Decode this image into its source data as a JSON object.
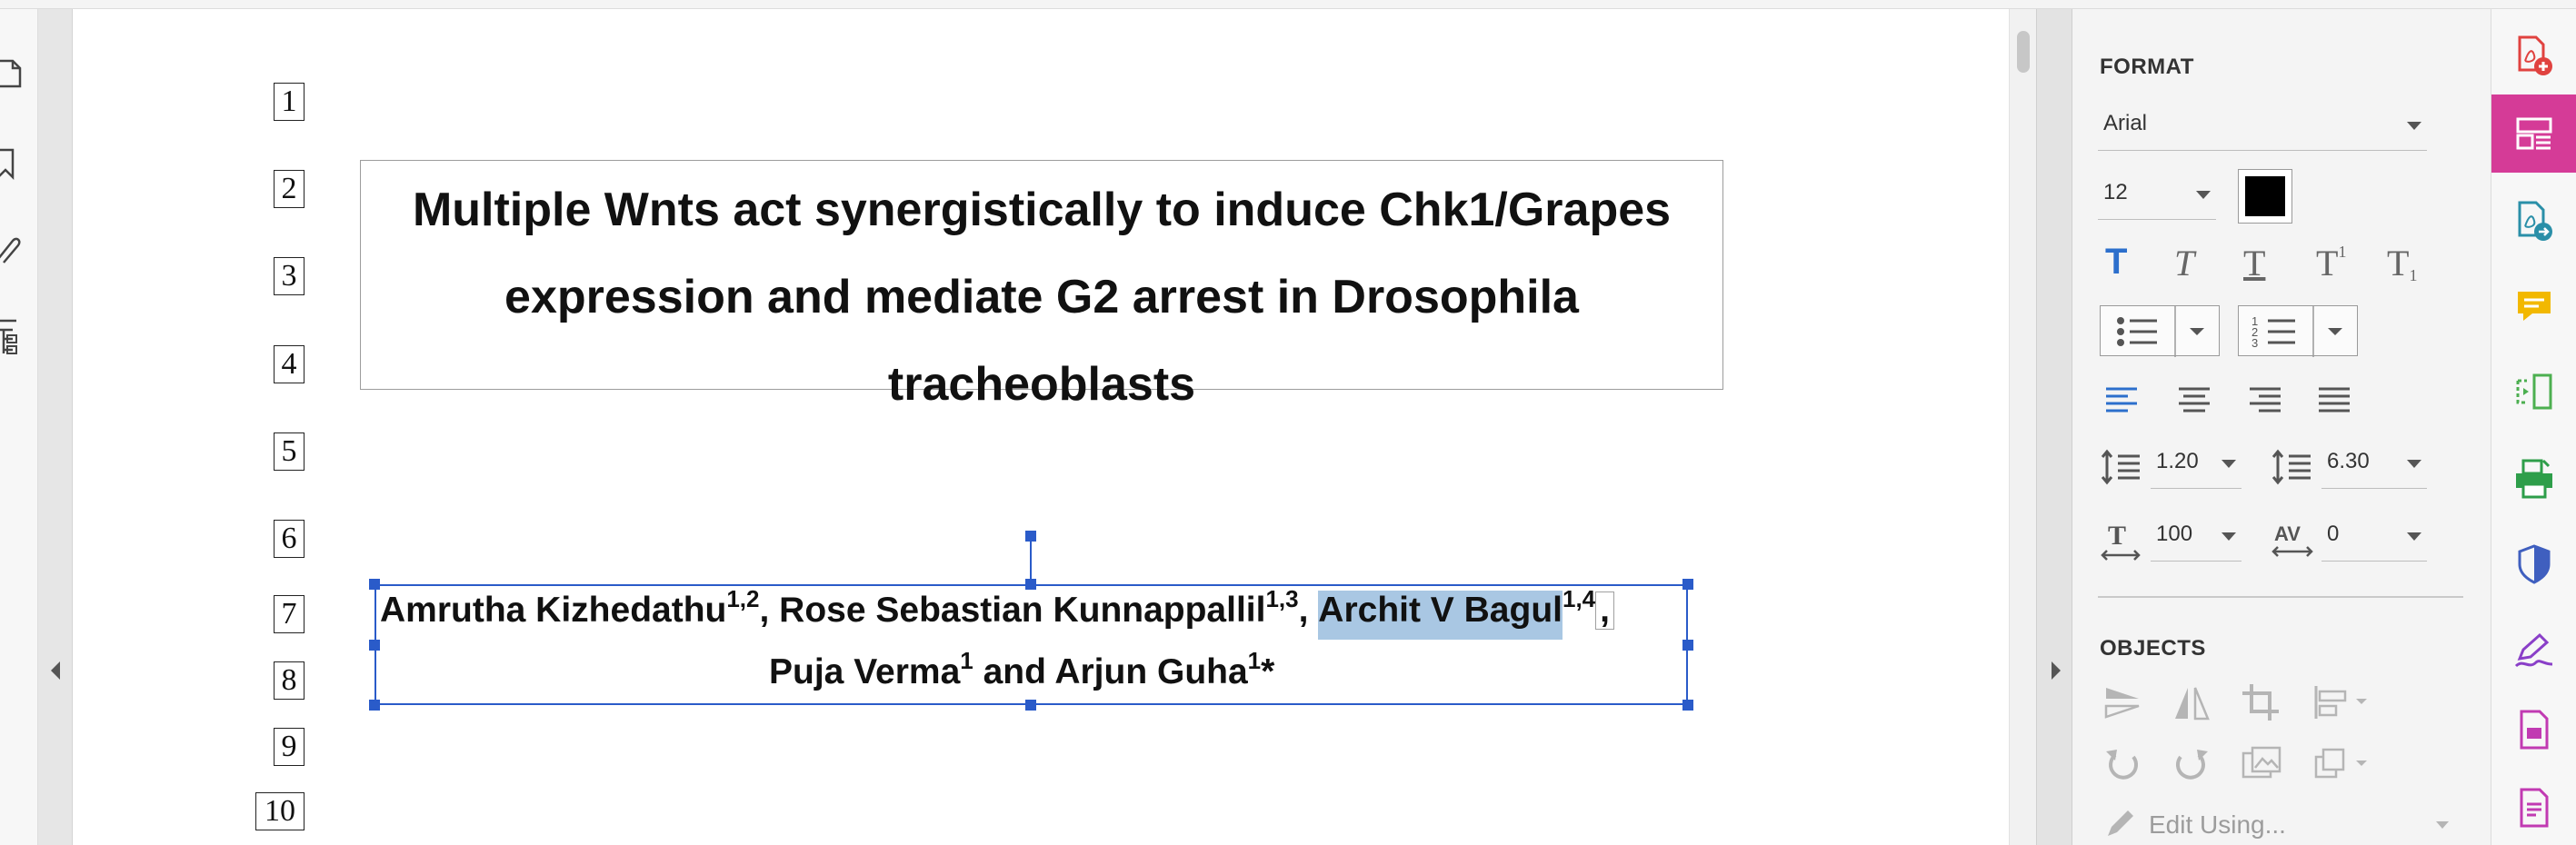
{
  "document": {
    "line_numbers": [
      "1",
      "2",
      "3",
      "4",
      "5",
      "6",
      "7",
      "8",
      "9",
      "10"
    ],
    "title_lines": [
      "Multiple Wnts act synergistically to induce Chk1/Grapes",
      "expression and mediate G2 arrest in Drosophila",
      "tracheoblasts"
    ],
    "authors": {
      "a1_name": "Amrutha Kizhedathu",
      "a1_sup": "1,2",
      "sep1": ", ",
      "a2_name": "Rose Sebastian Kunnappallil",
      "a2_sup": "1,3",
      "sep2": ", ",
      "a3_name": "Archit V Bagul",
      "a3_sup": "1,4",
      "sep3": ",",
      "a4_name": "Puja Verma",
      "a4_sup": "1",
      "and": " and ",
      "a5_name": "Arjun Guha",
      "a5_sup": "1",
      "a5_mark": "*"
    }
  },
  "format_panel": {
    "format_heading": "FORMAT",
    "font_family": "Arial",
    "font_size": "12",
    "text_color": "#000000",
    "line_spacing": "1.20",
    "paragraph_spacing": "6.30",
    "horizontal_scale": "100",
    "char_spacing": "0",
    "objects_heading": "OBJECTS",
    "edit_using": "Edit Using..."
  },
  "icons": {
    "left_tools": [
      "page-thumbnails-icon",
      "bookmark-icon",
      "attachment-icon",
      "structure-icon"
    ],
    "right_rail": [
      "create-pdf-icon",
      "edit-pdf-icon",
      "export-pdf-icon",
      "comment-icon",
      "organize-pages-icon",
      "print-production-icon",
      "protect-icon",
      "fill-sign-icon",
      "pdf-file-icon",
      "redact-icon"
    ]
  },
  "colors": {
    "accent_rail": "#d53b97",
    "selection": "#2a5bc9",
    "highlight": "#a9c7e3",
    "active_tool": "#2c6fcc"
  }
}
